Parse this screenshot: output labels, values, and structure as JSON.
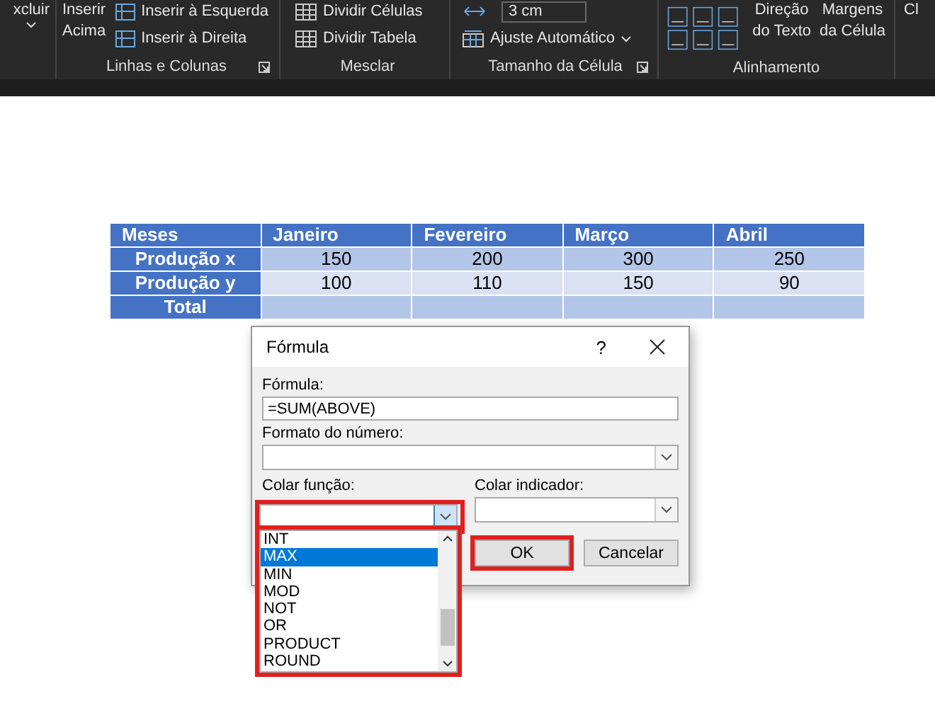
{
  "ribbon": {
    "groups": [
      {
        "kind": "delete",
        "items": [
          {
            "lines": [
              "xcluir"
            ]
          }
        ]
      },
      {
        "label": "Linhas e Colunas",
        "kind": "rows",
        "items": [
          {
            "lines": [
              "Inserir",
              "Acima"
            ]
          },
          {
            "label": "Inserir à Esquerda"
          },
          {
            "label": "Inserir à Direita"
          }
        ]
      },
      {
        "label": "Mesclar",
        "kind": "merge",
        "items": [
          {
            "label": "Dividir Células"
          },
          {
            "label": "Dividir Tabela"
          }
        ]
      },
      {
        "label": "Tamanho da Célula",
        "kind": "size",
        "items": [
          {
            "value": "3 cm"
          },
          {
            "label": "Ajuste Automático"
          }
        ]
      },
      {
        "label": "Alinhamento",
        "kind": "align",
        "items": [
          {
            "lines": [
              "Direção",
              "do Texto"
            ]
          },
          {
            "lines": [
              "Margens",
              "da Célula"
            ]
          }
        ]
      },
      {
        "kind": "cut",
        "items": [
          {
            "lines": [
              "Cl"
            ]
          }
        ]
      }
    ]
  },
  "table": {
    "columns": [
      "Meses",
      "Janeiro",
      "Fevereiro",
      "Março",
      "Abril"
    ],
    "rows": [
      {
        "cells": [
          "Produção x",
          "150",
          "200",
          "300",
          "250"
        ]
      },
      {
        "cells": [
          "Produção y",
          "100",
          "110",
          "150",
          "90"
        ]
      },
      {
        "cells": [
          "Total",
          "",
          "",
          "",
          ""
        ]
      }
    ]
  },
  "dialog": {
    "title": "Fórmula",
    "help": "?",
    "formula": {
      "label": "Fórmula:",
      "value": "=SUM(ABOVE)"
    },
    "number_format": {
      "label": "Formato do número:"
    },
    "paste_function": {
      "label": "Colar função:",
      "highlighted": true,
      "expanded": true,
      "options": [
        {
          "label": "INT",
          "selected": false
        },
        {
          "label": "MAX",
          "selected": true
        },
        {
          "label": "MIN",
          "selected": false
        },
        {
          "label": "MOD",
          "selected": false
        },
        {
          "label": "NOT",
          "selected": false
        },
        {
          "label": "OR",
          "selected": false
        },
        {
          "label": "PRODUCT",
          "selected": false
        },
        {
          "label": "ROUND",
          "selected": false
        }
      ]
    },
    "paste_bookmark": {
      "label": "Colar indicador:"
    },
    "buttons": [
      {
        "label": "OK",
        "highlighted": true
      },
      {
        "label": "Cancelar",
        "highlighted": false
      }
    ]
  }
}
